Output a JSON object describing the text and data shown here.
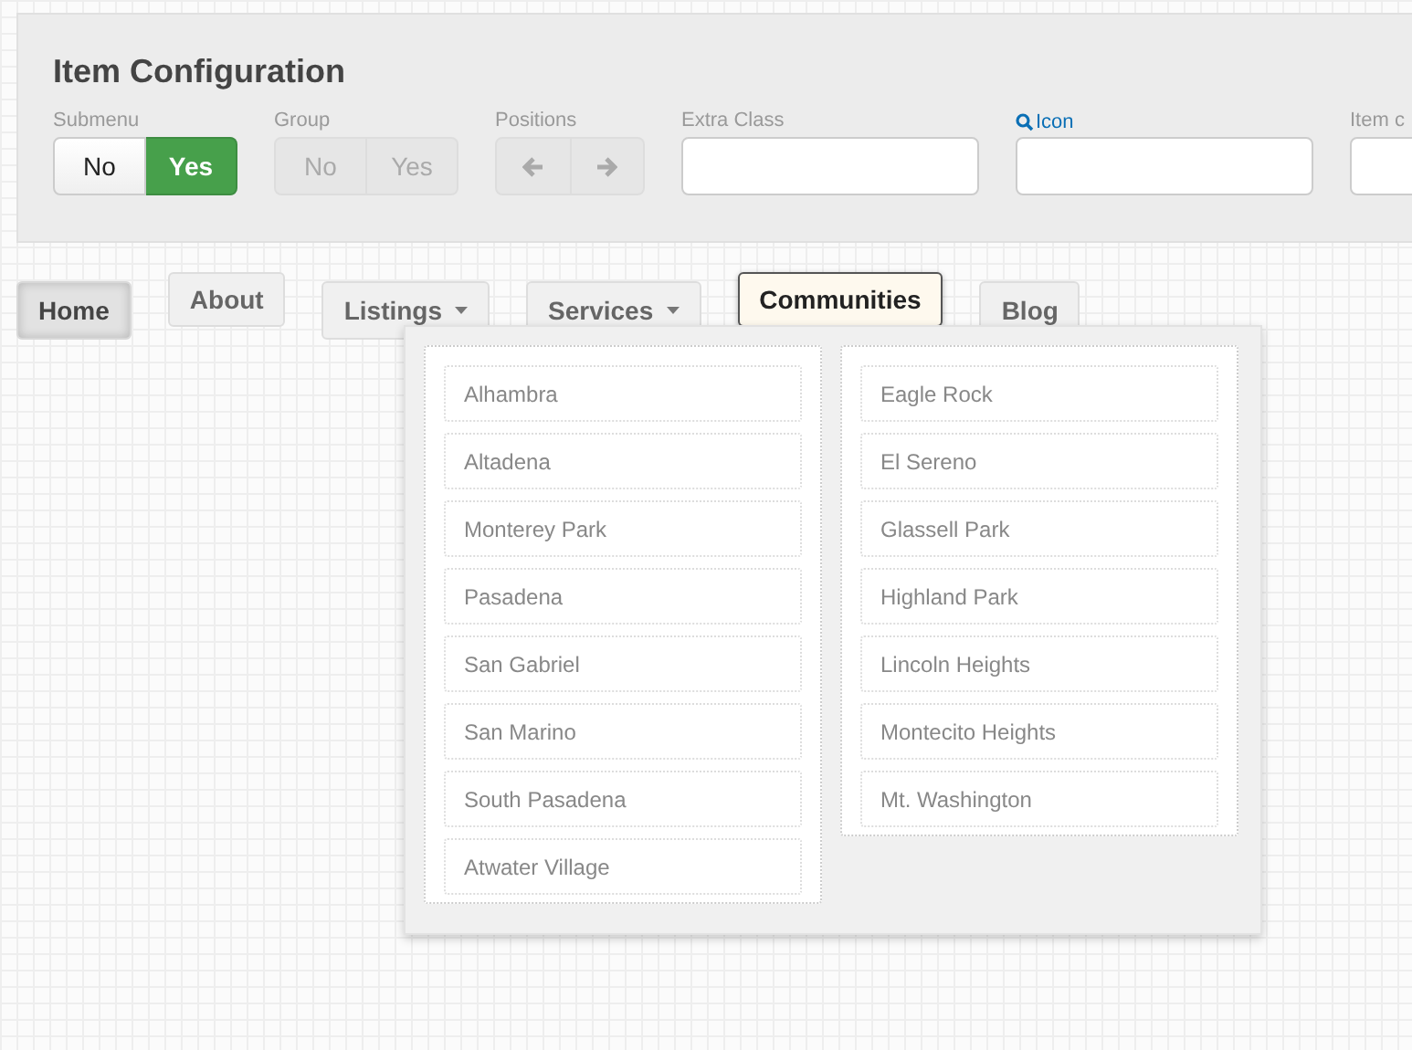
{
  "config": {
    "title": "Item Configuration",
    "fields": [
      {
        "kind": "toggle",
        "label": "Submenu",
        "disabled": false,
        "options": [
          {
            "label": "No",
            "selected": false
          },
          {
            "label": "Yes",
            "selected": true
          }
        ]
      },
      {
        "kind": "toggle",
        "label": "Group",
        "disabled": true,
        "options": [
          {
            "label": "No",
            "selected": false
          },
          {
            "label": "Yes",
            "selected": false
          }
        ]
      },
      {
        "kind": "arrows",
        "label": "Positions",
        "disabled": true
      },
      {
        "kind": "input",
        "label": "Extra Class",
        "link": false
      },
      {
        "kind": "input",
        "label": "Icon",
        "link": true
      },
      {
        "kind": "input",
        "label": "Item c",
        "link": false
      }
    ]
  },
  "nav": [
    {
      "label": "Home",
      "selected": true,
      "highlighted": false,
      "dropdown": false
    },
    {
      "label": "About",
      "selected": false,
      "highlighted": false,
      "dropdown": false
    },
    {
      "label": "Listings",
      "selected": false,
      "highlighted": false,
      "dropdown": true
    },
    {
      "label": "Services",
      "selected": false,
      "highlighted": false,
      "dropdown": true
    },
    {
      "label": "Communities",
      "selected": false,
      "highlighted": true,
      "dropdown": false
    },
    {
      "label": "Blog",
      "selected": false,
      "highlighted": false,
      "dropdown": false
    }
  ],
  "dropdown": {
    "columns": [
      [
        "Alhambra",
        "Altadena",
        "Monterey Park",
        "Pasadena",
        "San Gabriel",
        "San Marino",
        "South Pasadena",
        "Atwater Village"
      ],
      [
        "Eagle Rock",
        "El Sereno",
        "Glassell Park",
        "Highland Park",
        "Lincoln Heights",
        "Montecito Heights",
        "Mt. Washington"
      ]
    ]
  }
}
